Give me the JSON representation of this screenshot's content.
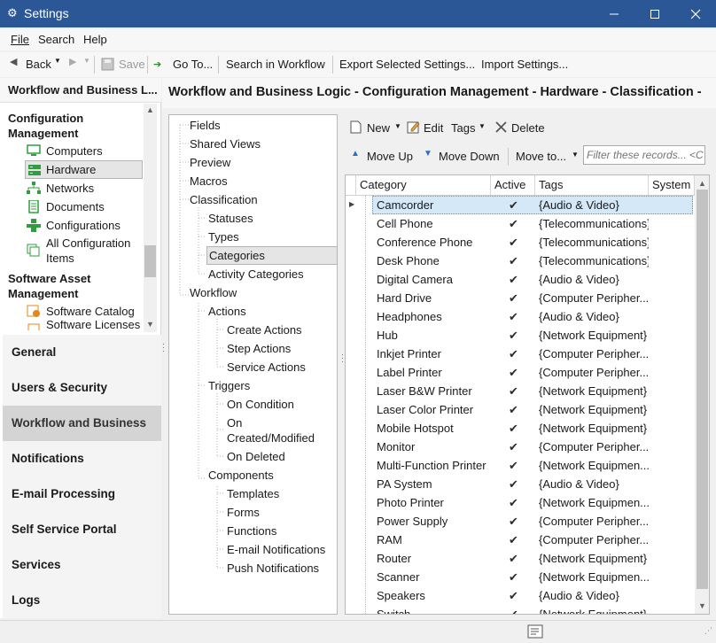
{
  "window": {
    "title": "Settings"
  },
  "menu": [
    "File",
    "Search",
    "Help"
  ],
  "toolbar": {
    "back": "Back",
    "save": "Save",
    "goto": "Go To...",
    "search_workflow": "Search in Workflow",
    "export": "Export Selected Settings...",
    "import": "Import Settings..."
  },
  "left": {
    "header": "Workflow and Business L...",
    "groups": [
      {
        "label": "Configuration Management"
      },
      {
        "label": "Software Asset Management"
      }
    ],
    "items": [
      {
        "label": "Computers",
        "icon": "computer-icon"
      },
      {
        "label": "Hardware",
        "icon": "hardware-icon"
      },
      {
        "label": "Networks",
        "icon": "network-icon"
      },
      {
        "label": "Documents",
        "icon": "document-icon"
      },
      {
        "label": "Configurations",
        "icon": "configuration-icon"
      },
      {
        "label": "All Configuration Items",
        "icon": "all-items-icon"
      },
      {
        "label": "Software Catalog",
        "icon": "software-catalog-icon"
      },
      {
        "label": "Software Licenses",
        "icon": "software-license-icon"
      }
    ],
    "nav": [
      "General",
      "Users & Security",
      "Workflow and Business L...",
      "Notifications",
      "E-mail Processing",
      "Self Service Portal",
      "Services",
      "Logs"
    ]
  },
  "main": {
    "title": "Workflow and Business Logic - Configuration Management - Hardware - Classification - "
  },
  "tree": [
    {
      "label": "Fields",
      "level": 0
    },
    {
      "label": "Shared Views",
      "level": 0
    },
    {
      "label": "Preview",
      "level": 0
    },
    {
      "label": "Macros",
      "level": 0
    },
    {
      "label": "Classification",
      "level": 0
    },
    {
      "label": "Statuses",
      "level": 1
    },
    {
      "label": "Types",
      "level": 1
    },
    {
      "label": "Categories",
      "level": 1
    },
    {
      "label": "Activity Categories",
      "level": 1
    },
    {
      "label": "Workflow",
      "level": 0
    },
    {
      "label": "Actions",
      "level": 1
    },
    {
      "label": "Create Actions",
      "level": 2
    },
    {
      "label": "Step Actions",
      "level": 2
    },
    {
      "label": "Service Actions",
      "level": 2
    },
    {
      "label": "Triggers",
      "level": 1
    },
    {
      "label": "On Condition",
      "level": 2
    },
    {
      "label": "On Created/Modified",
      "level": 2
    },
    {
      "label": "On Deleted",
      "level": 2
    },
    {
      "label": "Components",
      "level": 1
    },
    {
      "label": "Templates",
      "level": 2
    },
    {
      "label": "Forms",
      "level": 2
    },
    {
      "label": "Functions",
      "level": 2
    },
    {
      "label": "E-mail Notifications",
      "level": 2
    },
    {
      "label": "Push Notifications",
      "level": 2
    }
  ],
  "actions": {
    "new": "New",
    "edit": "Edit",
    "tags": "Tags",
    "delete": "Delete",
    "move_up": "Move Up",
    "move_down": "Move Down",
    "move_to": "Move to...",
    "filter_placeholder": "Filter these records... <C"
  },
  "grid": {
    "columns": [
      "Category",
      "Active",
      "Tags",
      "System"
    ],
    "rows": [
      {
        "category": "Camcorder",
        "active": "✔",
        "tags": "{Audio & Video}"
      },
      {
        "category": "Cell Phone",
        "active": "✔",
        "tags": "{Telecommunications}"
      },
      {
        "category": "Conference Phone",
        "active": "✔",
        "tags": "{Telecommunications}"
      },
      {
        "category": "Desk Phone",
        "active": "✔",
        "tags": "{Telecommunications}"
      },
      {
        "category": "Digital Camera",
        "active": "✔",
        "tags": "{Audio & Video}"
      },
      {
        "category": "Hard Drive",
        "active": "✔",
        "tags": "{Computer Peripher..."
      },
      {
        "category": "Headphones",
        "active": "✔",
        "tags": "{Audio & Video}"
      },
      {
        "category": "Hub",
        "active": "✔",
        "tags": "{Network Equipment}"
      },
      {
        "category": "Inkjet Printer",
        "active": "✔",
        "tags": "{Computer Peripher..."
      },
      {
        "category": "Label Printer",
        "active": "✔",
        "tags": "{Computer Peripher..."
      },
      {
        "category": "Laser B&W Printer",
        "active": "✔",
        "tags": "{Network Equipment}"
      },
      {
        "category": "Laser Color Printer",
        "active": "✔",
        "tags": "{Network Equipment}"
      },
      {
        "category": "Mobile Hotspot",
        "active": "✔",
        "tags": "{Network Equipment}"
      },
      {
        "category": "Monitor",
        "active": "✔",
        "tags": "{Computer Peripher..."
      },
      {
        "category": "Multi-Function Printer",
        "active": "✔",
        "tags": "{Network Equipmen..."
      },
      {
        "category": "PA System",
        "active": "✔",
        "tags": "{Audio & Video}"
      },
      {
        "category": "Photo Printer",
        "active": "✔",
        "tags": "{Network Equipmen..."
      },
      {
        "category": "Power Supply",
        "active": "✔",
        "tags": "{Computer Peripher..."
      },
      {
        "category": "RAM",
        "active": "✔",
        "tags": "{Computer Peripher..."
      },
      {
        "category": "Router",
        "active": "✔",
        "tags": "{Network Equipment}"
      },
      {
        "category": "Scanner",
        "active": "✔",
        "tags": "{Network Equipmen..."
      },
      {
        "category": "Speakers",
        "active": "✔",
        "tags": "{Audio & Video}"
      },
      {
        "category": "Switch",
        "active": "✔",
        "tags": "{Network Equipment}"
      }
    ]
  },
  "colors": {
    "titlebar": "#2b5797",
    "selection": "#d5e8f8"
  }
}
